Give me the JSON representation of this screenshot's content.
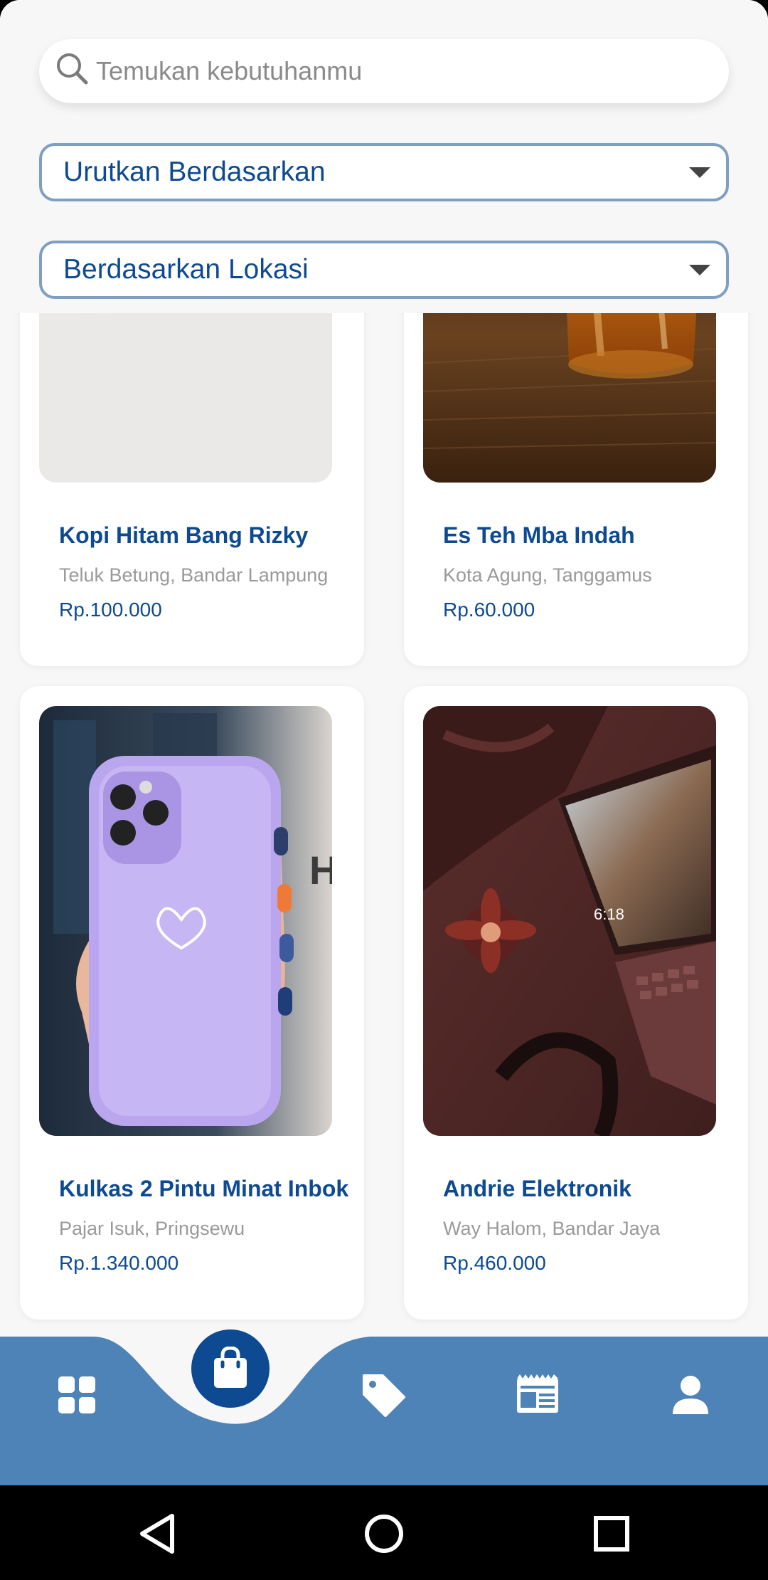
{
  "header": {
    "search": {
      "placeholder": "Temukan kebutuhanmu"
    },
    "sort_dropdown": {
      "label": "Urutkan Berdasarkan"
    },
    "location_dropdown": {
      "label": "Berdasarkan Lokasi"
    }
  },
  "products": [
    {
      "title": "Kopi Hitam Bang Rizky",
      "location": "Teluk Betung, Bandar Lampung",
      "price": "Rp.100.000",
      "image": "coffee-cup-photo"
    },
    {
      "title": "Es Teh Mba Indah",
      "location": "Kota Agung, Tanggamus",
      "price": "Rp.60.000",
      "image": "iced-tea-photo"
    },
    {
      "title": "Kulkas 2 Pintu Minat Inbok",
      "location": "Pajar Isuk, Pringsewu",
      "price": "Rp.1.340.000",
      "image": "purple-phone-case-photo"
    },
    {
      "title": "Andrie Elektronik",
      "location": "Way Halom, Bandar Jaya",
      "price": "Rp.460.000",
      "image": "laptop-desk-photo"
    }
  ],
  "bottom_nav": {
    "items": [
      "grid-icon",
      "shopping-bag-icon",
      "tag-icon",
      "newspaper-icon",
      "person-icon"
    ],
    "active": "shopping-bag-icon",
    "colors": {
      "bar": "#4e83b8",
      "active": "#0d4a91",
      "icon": "#ffffff"
    }
  },
  "system_nav": {
    "items": [
      "back-icon",
      "home-icon",
      "recents-icon"
    ]
  },
  "colors": {
    "primary": "#0d4a91",
    "accent_border": "#7f9fc2",
    "muted_text": "#9a9a9a",
    "background": "#f7f7f7"
  }
}
